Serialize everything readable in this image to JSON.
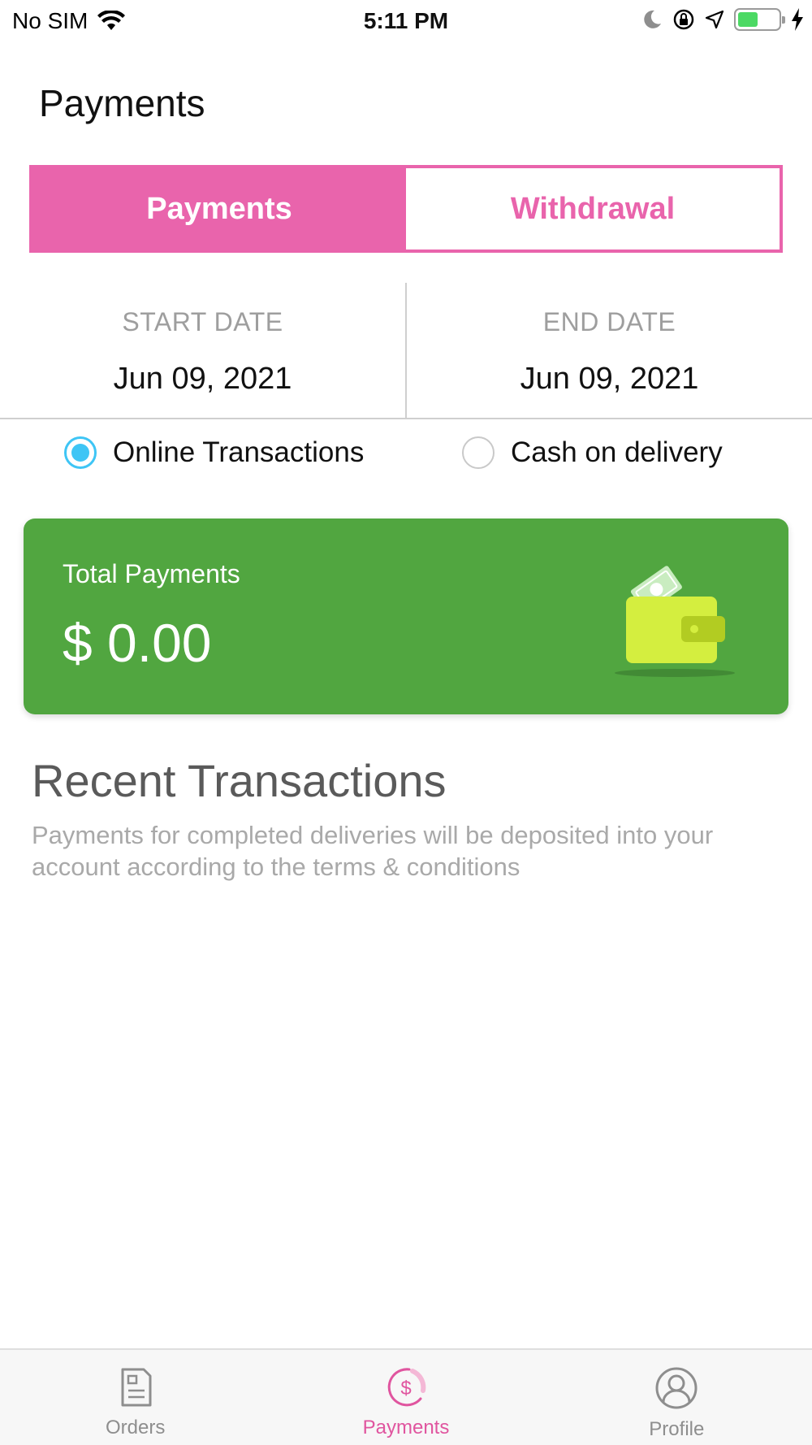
{
  "status_bar": {
    "carrier": "No SIM",
    "time": "5:11 PM",
    "battery_level": 0.5
  },
  "header": {
    "title": "Payments"
  },
  "segments": {
    "payments_label": "Payments",
    "withdrawal_label": "Withdrawal",
    "active": "Payments"
  },
  "dates": {
    "start_label": "START DATE",
    "start_value": "Jun 09, 2021",
    "end_label": "END DATE",
    "end_value": "Jun 09, 2021"
  },
  "filters": {
    "online_label": "Online Transactions",
    "cod_label": "Cash on delivery",
    "selected": "Online Transactions"
  },
  "summary": {
    "label": "Total Payments",
    "amount": "$ 0.00"
  },
  "recent": {
    "title": "Recent Transactions",
    "description": "Payments for completed deliveries will be deposited into your account according to the terms & conditions"
  },
  "tab_bar": {
    "items": [
      {
        "label": "Orders",
        "icon": "document-icon"
      },
      {
        "label": "Payments",
        "icon": "dollar-icon"
      },
      {
        "label": "Profile",
        "icon": "person-icon"
      }
    ],
    "active": "Payments"
  },
  "colors": {
    "accent_pink": "#e964ac",
    "card_green": "#51a640",
    "radio_blue": "#3ec5f5",
    "wallet_yellow": "#d4ee3f"
  }
}
